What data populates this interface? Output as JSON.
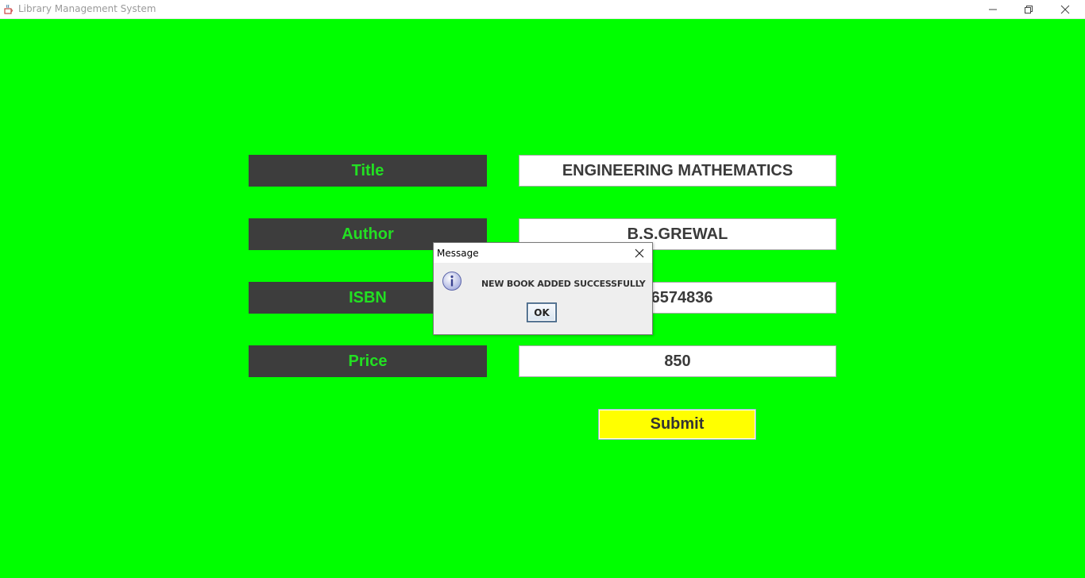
{
  "window": {
    "title": "Library Management System",
    "icon": "java-cup-icon"
  },
  "form": {
    "fields": [
      {
        "label": "Title",
        "value": "ENGINEERING MATHEMATICS"
      },
      {
        "label": "Author",
        "value": "B.S.GREWAL"
      },
      {
        "label": "ISBN",
        "value": "46574836"
      },
      {
        "label": "Price",
        "value": "850"
      }
    ],
    "submit_label": "Submit"
  },
  "dialog": {
    "title": "Message",
    "icon": "info-icon",
    "message": "NEW BOOK  ADDED SUCCESSFULLY",
    "ok_label": "OK"
  },
  "colors": {
    "background": "#00ff00",
    "label_bg": "#3d3d3d",
    "label_text": "#22e022",
    "submit_bg": "#ffff00"
  }
}
